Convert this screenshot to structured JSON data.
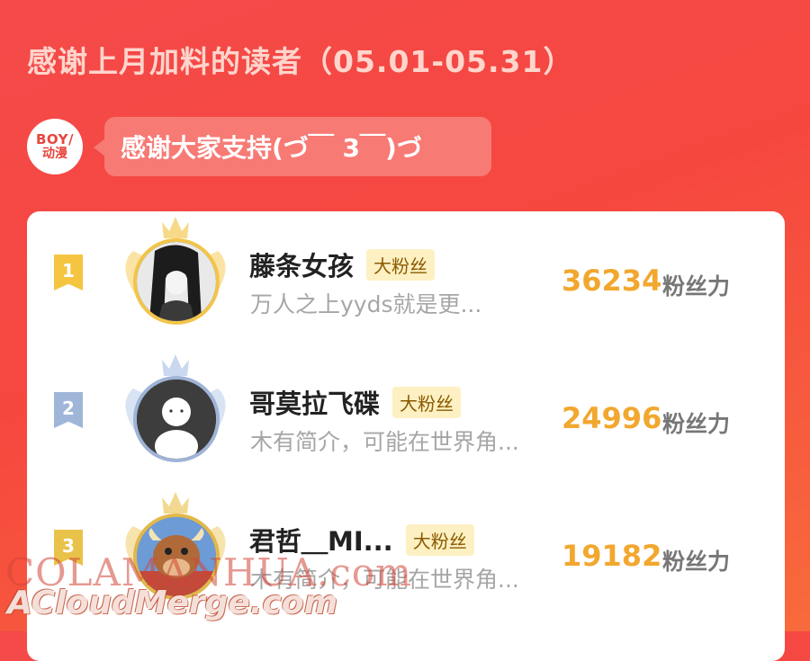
{
  "header": {
    "title": "感谢上月加料的读者（05.01-05.31）"
  },
  "brand": {
    "logo_line1": "BOY/",
    "logo_line2": "动漫",
    "message": "感谢大家支持(づ￣ 3￣)づ"
  },
  "ranking": [
    {
      "rank": "1",
      "name": "藤条女孩",
      "tag": "大粉丝",
      "bio": "万人之上yyds就是更...",
      "score": "36234",
      "unit": "粉丝力",
      "rank_color": "#f5c542",
      "avatar_icon": "anime-character-avatar"
    },
    {
      "rank": "2",
      "name": "哥莫拉飞碟",
      "tag": "大粉丝",
      "bio": "木有简介，可能在世界角...",
      "score": "24996",
      "unit": "粉丝力",
      "rank_color": "#9fb6d9",
      "avatar_icon": "default-user-avatar"
    },
    {
      "rank": "3",
      "name": "君哲＿MI...",
      "tag": "大粉丝",
      "bio": "木有简介，可能在世界角...",
      "score": "19182",
      "unit": "粉丝力",
      "rank_color": "#e9c24a",
      "avatar_icon": "cartoon-ox-avatar"
    }
  ],
  "watermarks": {
    "line1": "COLAMANHUA.com",
    "line2": "ACloudMerge.com"
  },
  "colors": {
    "background": "#f44a4a",
    "score": "#f2a72e",
    "tag_bg": "#fdf0c2"
  }
}
